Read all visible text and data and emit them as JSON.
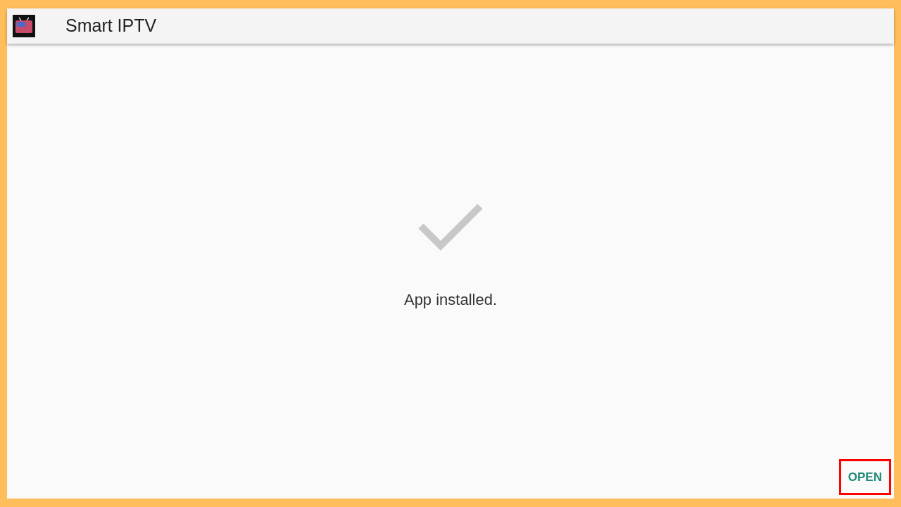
{
  "app_bar": {
    "title": "Smart IPTV"
  },
  "message": "App installed.",
  "actions": [
    {
      "label": "OPEN",
      "highlighted": true
    }
  ]
}
